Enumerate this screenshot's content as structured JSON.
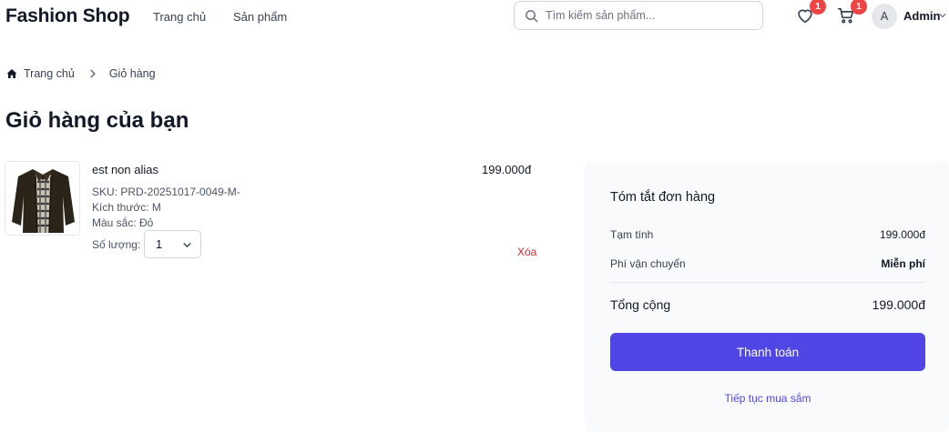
{
  "header": {
    "brand": "Fashion Shop",
    "nav": [
      {
        "label": "Trang chủ"
      },
      {
        "label": "Sản phẩm"
      }
    ],
    "search": {
      "placeholder": "Tìm kiếm sản phẩm...",
      "icon": "search-icon"
    },
    "wishlist": {
      "icon": "heart-icon",
      "count": "1"
    },
    "cart": {
      "icon": "cart-icon",
      "count": "1"
    },
    "user": {
      "initial": "A",
      "name": "Admin",
      "icon": "chevron-down-icon"
    }
  },
  "breadcrumb": {
    "home": "Trang chủ",
    "current": "Giỏ hàng"
  },
  "page_title": "Giỏ hàng của bạn",
  "cart": {
    "items": [
      {
        "name": "est non alias",
        "sku": "SKU: PRD-20251017-0049-M-",
        "size": "Kích thước: M",
        "color": "Màu sắc: Đỏ",
        "qty_label": "Số lượng:",
        "qty": "1",
        "price": "199.000đ",
        "remove": "Xóa"
      }
    ]
  },
  "summary": {
    "title": "Tóm tắt đơn hàng",
    "subtotal_label": "Tạm tính",
    "subtotal": "199.000đ",
    "shipping_label": "Phí vận chuyển",
    "shipping": "Miễn phí",
    "total_label": "Tổng cộng",
    "total": "199.000đ",
    "checkout": "Thanh toán",
    "continue": "Tiếp tục mua sắm"
  },
  "colors": {
    "accent": "#4f46e5",
    "danger": "#dc2626",
    "badge": "#ef4444"
  }
}
